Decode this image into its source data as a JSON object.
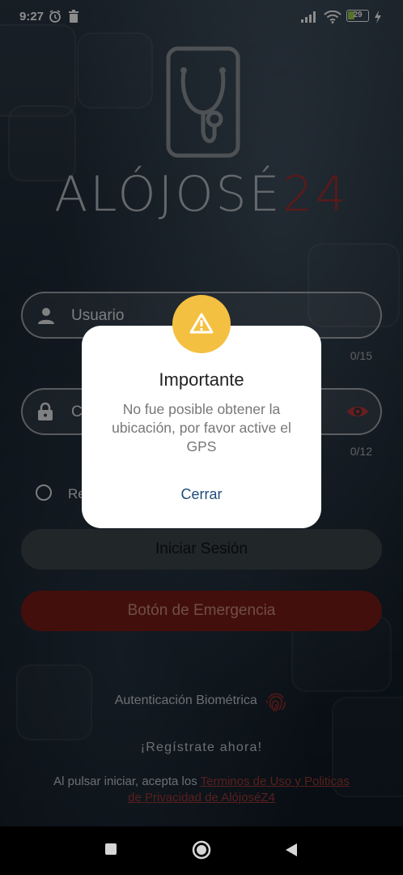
{
  "status_bar": {
    "time": "9:27",
    "battery": "29",
    "icons": [
      "alarm-icon",
      "delete-icon",
      "signal-icon",
      "wifi-icon",
      "battery-icon",
      "charging-icon"
    ]
  },
  "logo": {
    "text_light": "ALÓJOSÉ",
    "text_red": "24",
    "colors": {
      "light": "#b9c0c6",
      "red": "#a33131"
    }
  },
  "form": {
    "username": {
      "placeholder": "Usuario",
      "value": "",
      "counter": "0/15"
    },
    "password": {
      "placeholder": "Contraseña",
      "value": "",
      "counter": "0/12"
    },
    "remember_label": "Recordar"
  },
  "buttons": {
    "login": "Iniciar Sesión",
    "emergency": "Botón de Emergencia"
  },
  "biometric_label": "Autenticación Biométrica",
  "register_label": "¡Regístrate ahora!",
  "terms": {
    "prefix": "Al pulsar iniciar, acepta los ",
    "link": "Terminos de Uso y Politicas de Privacidad de AlójoséZ4"
  },
  "dialog": {
    "title": "Importante",
    "message": "No fue posible obtener la ubicación, por favor active el GPS",
    "close_label": "Cerrar",
    "badge_color": "#f4c042"
  },
  "colors": {
    "accent_red": "#7b1d17",
    "dialog_link": "#1f4c7a"
  }
}
